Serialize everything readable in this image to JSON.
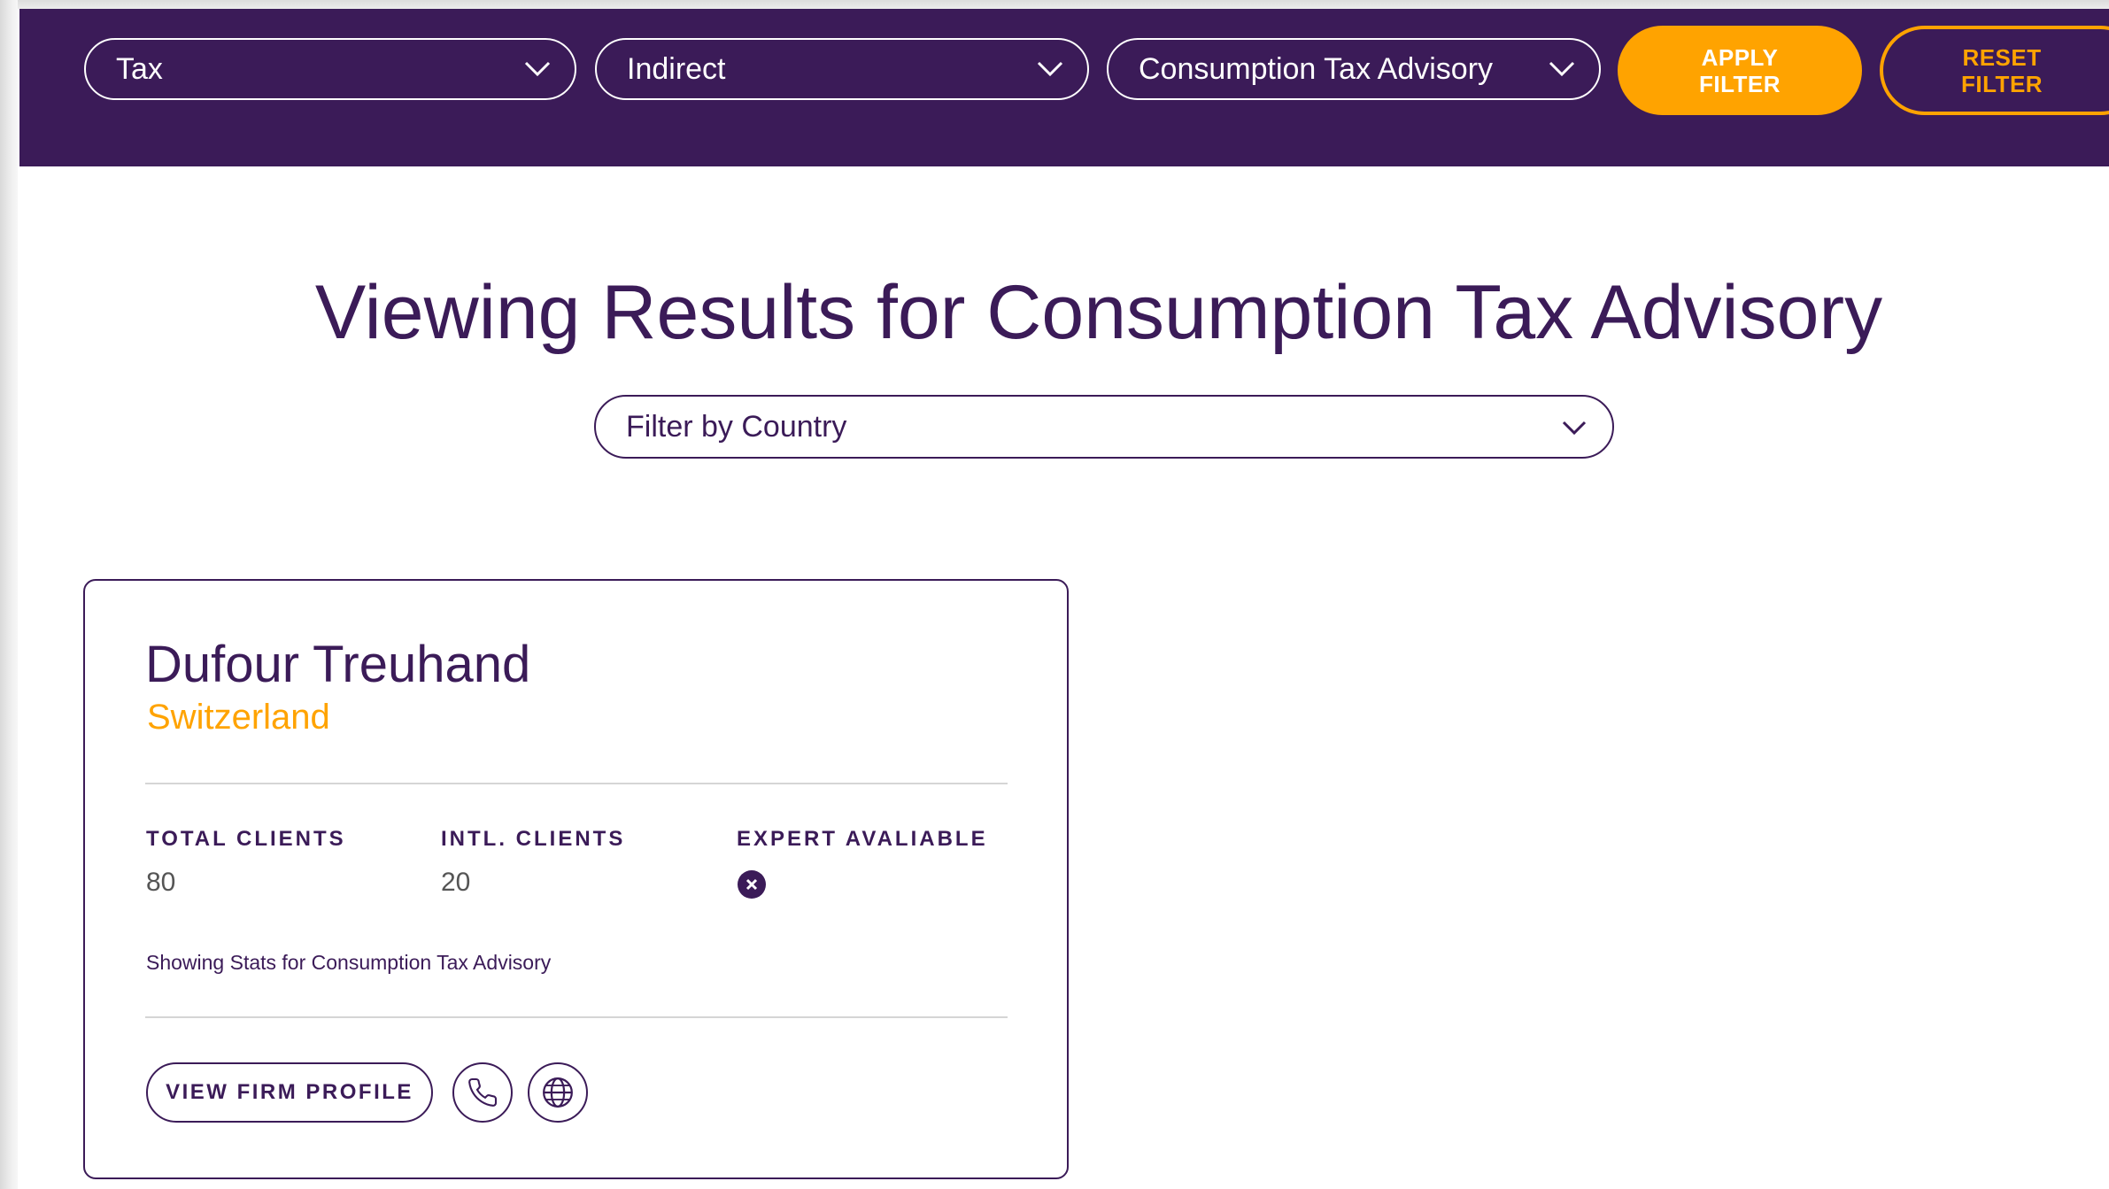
{
  "filters": {
    "category": {
      "value": "Tax"
    },
    "subcategory": {
      "value": "Indirect"
    },
    "service": {
      "value": "Consumption Tax Advisory"
    },
    "apply_label": "APPLY\nFILTER",
    "reset_label": "RESET\nFILTER"
  },
  "results": {
    "heading": "Viewing Results for Consumption Tax Advisory",
    "country_filter": {
      "placeholder": "Filter by Country"
    }
  },
  "firm": {
    "name": "Dufour Treuhand",
    "country": "Switzerland",
    "stats": {
      "total_clients_label": "TOTAL CLIENTS",
      "total_clients_value": "80",
      "intl_clients_label": "INTL. CLIENTS",
      "intl_clients_value": "20",
      "expert_label": "EXPERT AVALIABLE",
      "expert_available": false
    },
    "stats_note": "Showing Stats for Consumption Tax Advisory",
    "view_profile_label": "VIEW FIRM PROFILE"
  },
  "icons": {
    "chevron": "chevron-down-icon",
    "expert_status": "x-circle-icon",
    "phone": "phone-icon",
    "website": "globe-icon"
  },
  "colors": {
    "brand_purple": "#3b1b58",
    "accent_orange": "#ffa300",
    "text_gray": "#555555",
    "divider": "#d5d5d5"
  }
}
